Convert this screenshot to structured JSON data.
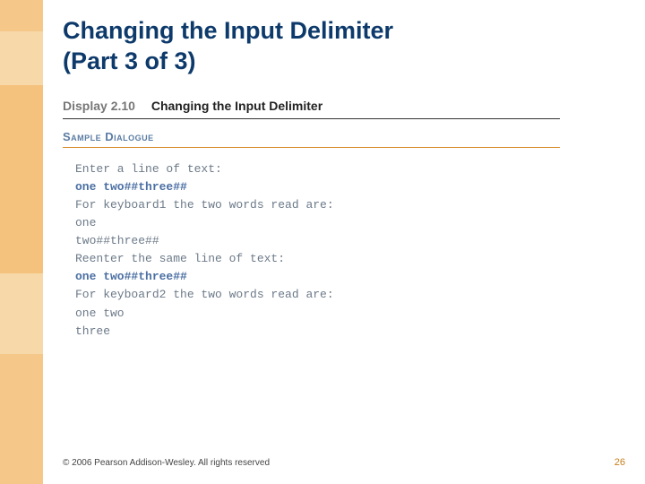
{
  "title_line1": "Changing the Input Delimiter",
  "title_line2": "(Part 3 of 3)",
  "display": {
    "number": "Display 2.10",
    "caption": "Changing the Input Delimiter",
    "sample_label": "Sample Dialogue",
    "lines": [
      {
        "text": "Enter a line of text:",
        "user": false
      },
      {
        "text": "one two##three##",
        "user": true
      },
      {
        "text": "For keyboard1 the two words read are:",
        "user": false
      },
      {
        "text": "one",
        "user": false
      },
      {
        "text": "two##three##",
        "user": false
      },
      {
        "text": "Reenter the same line of text:",
        "user": false
      },
      {
        "text": "one two##three##",
        "user": true
      },
      {
        "text": "For keyboard2 the two words read are:",
        "user": false
      },
      {
        "text": "one two",
        "user": false
      },
      {
        "text": "three",
        "user": false
      }
    ]
  },
  "footer": {
    "copyright": "© 2006 Pearson Addison-Wesley. All rights reserved",
    "page_number": "26"
  }
}
